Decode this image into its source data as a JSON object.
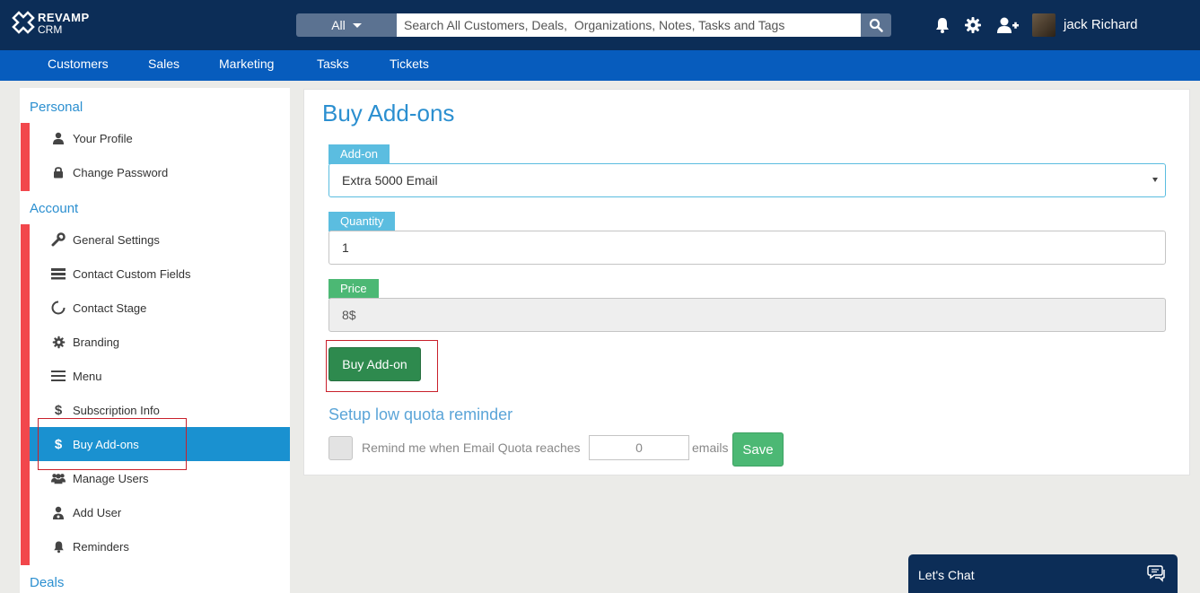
{
  "brand": {
    "line1": "REVAMP",
    "line2": "CRM"
  },
  "search": {
    "category": "All",
    "placeholder": "Search All Customers, Deals,  Organizations, Notes, Tasks and Tags"
  },
  "user": {
    "name": "jack Richard"
  },
  "nav": [
    "Customers",
    "Sales",
    "Marketing",
    "Tasks",
    "Tickets"
  ],
  "sidebar": {
    "personal_title": "Personal",
    "personal_items": [
      "Your Profile",
      "Change Password"
    ],
    "account_title": "Account",
    "account_items": [
      "General Settings",
      "Contact Custom Fields",
      "Contact Stage",
      "Branding",
      "Menu",
      "Subscription Info",
      "Buy Add-ons",
      "Manage Users",
      "Add User",
      "Reminders"
    ],
    "deals_title": "Deals"
  },
  "main": {
    "title": "Buy Add-ons",
    "addon_label": "Add-on",
    "addon_value": "Extra 5000 Email",
    "quantity_label": "Quantity",
    "quantity_value": "1",
    "price_label": "Price",
    "price_value": "8$",
    "buy_button": "Buy Add-on",
    "reminder_title": "Setup low quota reminder",
    "reminder_text": "Remind me when Email Quota reaches",
    "quota_value": "0",
    "emails_text": "emails",
    "save_button": "Save"
  },
  "chat": {
    "label": "Let's Chat"
  },
  "colors": {
    "topbar": "#0c2d57",
    "navbar": "#075cbd",
    "accent": "#2b8fd0",
    "active": "#1a91d0",
    "sidebar_bar": "#f2474c",
    "tag_blue": "#5bbde0",
    "tag_green": "#4cb874",
    "buy": "#2e8a4e"
  }
}
